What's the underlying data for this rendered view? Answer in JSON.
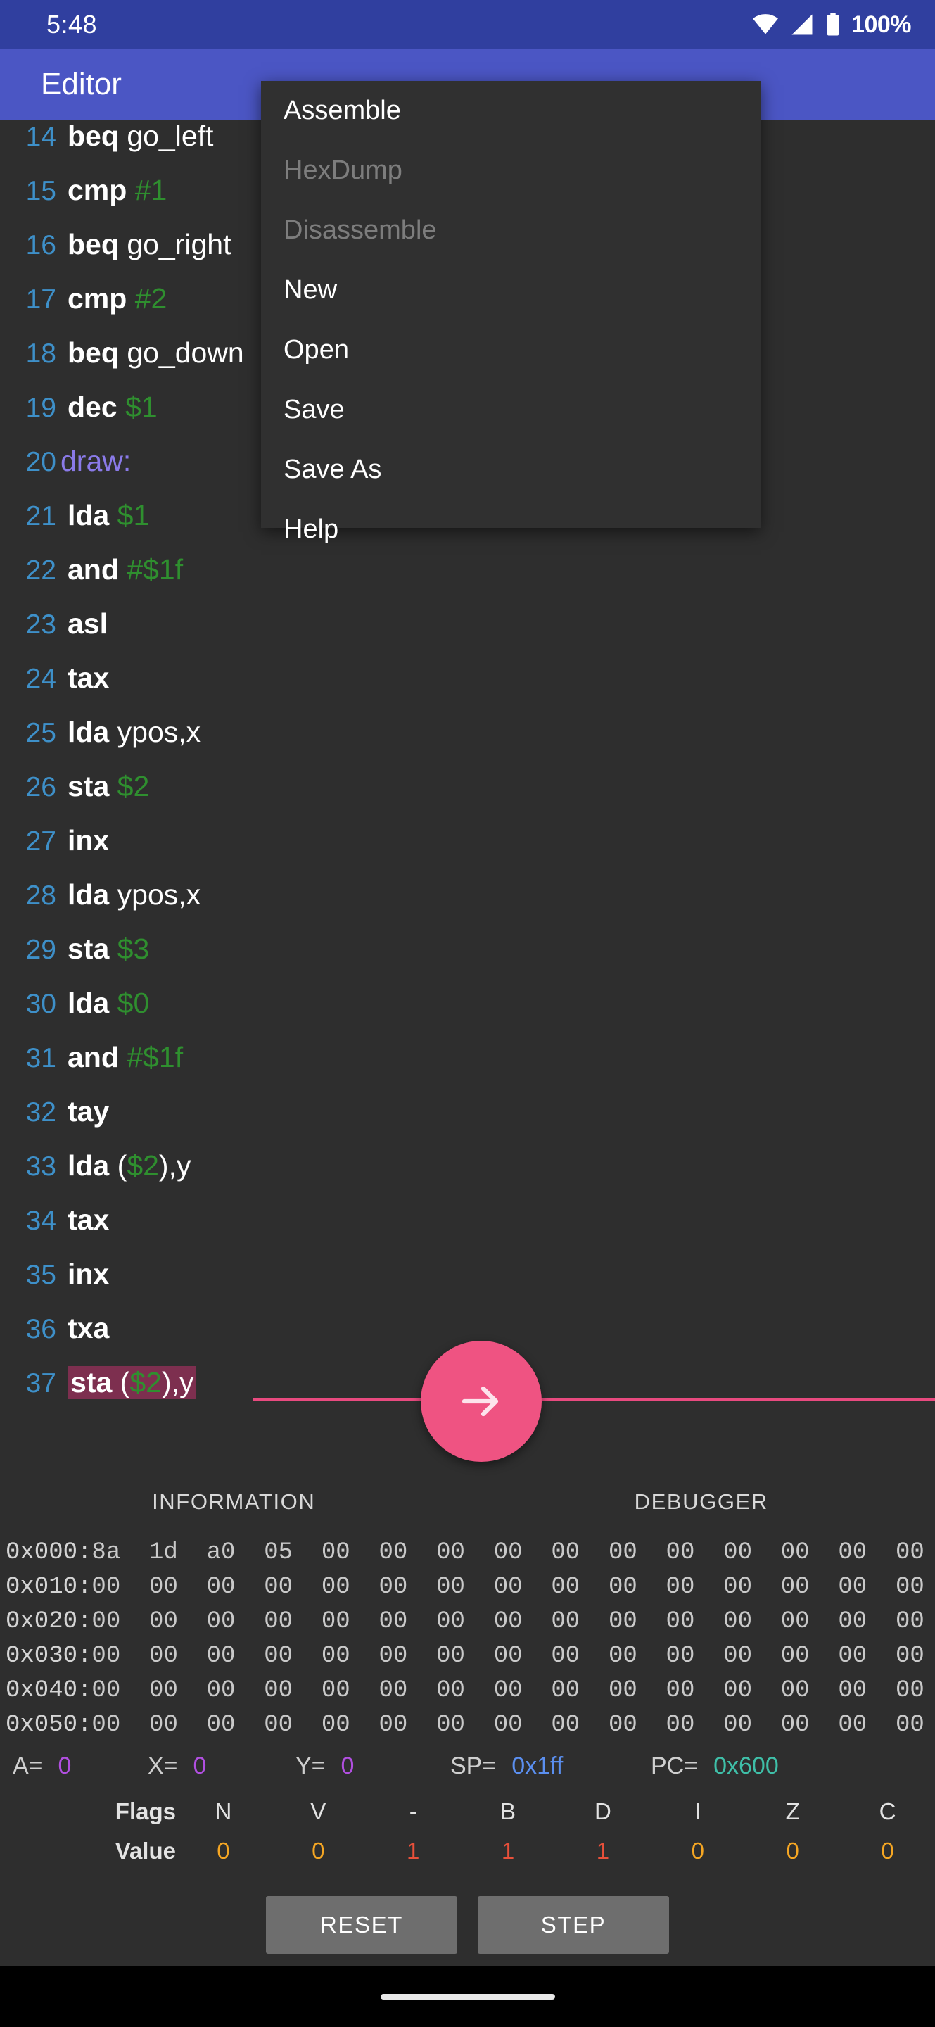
{
  "status_bar": {
    "time": "5:48",
    "battery_percent": "100%",
    "icons": [
      "wifi-icon",
      "cellular-signal-icon",
      "battery-icon"
    ]
  },
  "app_bar": {
    "title": "Editor"
  },
  "overflow_menu": {
    "items": [
      {
        "label": "Assemble",
        "disabled": false
      },
      {
        "label": "HexDump",
        "disabled": true
      },
      {
        "label": "Disassemble",
        "disabled": true
      },
      {
        "label": "New",
        "disabled": false
      },
      {
        "label": "Open",
        "disabled": false
      },
      {
        "label": "Save",
        "disabled": false
      },
      {
        "label": "Save As",
        "disabled": false
      },
      {
        "label": "Help",
        "disabled": false
      }
    ]
  },
  "editor": {
    "lines": [
      {
        "no": "14",
        "type": "instr",
        "mnemonic": "beq",
        "operand": "go_left",
        "operand_kind": "plain",
        "selected": false
      },
      {
        "no": "15",
        "type": "instr",
        "mnemonic": "cmp",
        "operand": "#1",
        "operand_kind": "number",
        "selected": false
      },
      {
        "no": "16",
        "type": "instr",
        "mnemonic": "beq",
        "operand": "go_right",
        "operand_kind": "plain",
        "selected": false
      },
      {
        "no": "17",
        "type": "instr",
        "mnemonic": "cmp",
        "operand": "#2",
        "operand_kind": "number",
        "selected": false
      },
      {
        "no": "18",
        "type": "instr",
        "mnemonic": "beq",
        "operand": "go_down",
        "operand_kind": "plain",
        "selected": false
      },
      {
        "no": "19",
        "type": "instr",
        "mnemonic": "dec",
        "operand": "$1",
        "operand_kind": "number",
        "selected": false
      },
      {
        "no": "20",
        "type": "label",
        "mnemonic": "draw:",
        "operand": "",
        "operand_kind": "label",
        "selected": false
      },
      {
        "no": "21",
        "type": "instr",
        "mnemonic": "lda",
        "operand": "$1",
        "operand_kind": "number",
        "selected": false
      },
      {
        "no": "22",
        "type": "instr",
        "mnemonic": "and",
        "operand": "#$1f",
        "operand_kind": "number",
        "selected": false
      },
      {
        "no": "23",
        "type": "instr",
        "mnemonic": "asl",
        "operand": "",
        "operand_kind": "plain",
        "selected": false
      },
      {
        "no": "24",
        "type": "instr",
        "mnemonic": "tax",
        "operand": "",
        "operand_kind": "plain",
        "selected": false
      },
      {
        "no": "25",
        "type": "instr",
        "mnemonic": "lda",
        "operand": "ypos,x",
        "operand_kind": "plain",
        "selected": false
      },
      {
        "no": "26",
        "type": "instr",
        "mnemonic": "sta",
        "operand": "$2",
        "operand_kind": "number",
        "selected": false
      },
      {
        "no": "27",
        "type": "instr",
        "mnemonic": "inx",
        "operand": "",
        "operand_kind": "plain",
        "selected": false
      },
      {
        "no": "28",
        "type": "instr",
        "mnemonic": "lda",
        "operand": "ypos,x",
        "operand_kind": "plain",
        "selected": false
      },
      {
        "no": "29",
        "type": "instr",
        "mnemonic": "sta",
        "operand": "$3",
        "operand_kind": "number",
        "selected": false
      },
      {
        "no": "30",
        "type": "instr",
        "mnemonic": "lda",
        "operand": "$0",
        "operand_kind": "number",
        "selected": false
      },
      {
        "no": "31",
        "type": "instr",
        "mnemonic": "and",
        "operand": "#$1f",
        "operand_kind": "number",
        "selected": false
      },
      {
        "no": "32",
        "type": "instr",
        "mnemonic": "tay",
        "operand": "",
        "operand_kind": "plain",
        "selected": false
      },
      {
        "no": "33",
        "type": "instr",
        "mnemonic": "lda",
        "operand": "($2),y",
        "operand_kind": "indirect",
        "selected": false
      },
      {
        "no": "34",
        "type": "instr",
        "mnemonic": "tax",
        "operand": "",
        "operand_kind": "plain",
        "selected": false
      },
      {
        "no": "35",
        "type": "instr",
        "mnemonic": "inx",
        "operand": "",
        "operand_kind": "plain",
        "selected": false
      },
      {
        "no": "36",
        "type": "instr",
        "mnemonic": "txa",
        "operand": "",
        "operand_kind": "plain",
        "selected": false
      },
      {
        "no": "37",
        "type": "instr",
        "mnemonic": "sta",
        "operand": "($2),y",
        "operand_kind": "indirect",
        "selected": true
      }
    ]
  },
  "fab": {
    "icon": "arrow-right-icon"
  },
  "tabs": [
    {
      "label": "INFORMATION",
      "active": false
    },
    {
      "label": "DEBUGGER",
      "active": true
    }
  ],
  "hexdump": {
    "rows": [
      {
        "addr": "0x000:",
        "bytes": [
          "8a",
          "1d",
          "a0",
          "05",
          "00",
          "00",
          "00",
          "00",
          "00",
          "00",
          "00",
          "00",
          "00",
          "00",
          "00",
          "00"
        ]
      },
      {
        "addr": "0x010:",
        "bytes": [
          "00",
          "00",
          "00",
          "00",
          "00",
          "00",
          "00",
          "00",
          "00",
          "00",
          "00",
          "00",
          "00",
          "00",
          "00",
          "00"
        ]
      },
      {
        "addr": "0x020:",
        "bytes": [
          "00",
          "00",
          "00",
          "00",
          "00",
          "00",
          "00",
          "00",
          "00",
          "00",
          "00",
          "00",
          "00",
          "00",
          "00",
          "00"
        ]
      },
      {
        "addr": "0x030:",
        "bytes": [
          "00",
          "00",
          "00",
          "00",
          "00",
          "00",
          "00",
          "00",
          "00",
          "00",
          "00",
          "00",
          "00",
          "00",
          "00",
          "00"
        ]
      },
      {
        "addr": "0x040:",
        "bytes": [
          "00",
          "00",
          "00",
          "00",
          "00",
          "00",
          "00",
          "00",
          "00",
          "00",
          "00",
          "00",
          "00",
          "00",
          "00",
          "00"
        ]
      },
      {
        "addr": "0x050:",
        "bytes": [
          "00",
          "00",
          "00",
          "00",
          "00",
          "00",
          "00",
          "00",
          "00",
          "00",
          "00",
          "00",
          "00",
          "00",
          "00",
          "00"
        ]
      }
    ]
  },
  "registers": [
    {
      "name": "A=",
      "value": "0",
      "color_class": "purple"
    },
    {
      "name": "X=",
      "value": "0",
      "color_class": "purple"
    },
    {
      "name": "Y=",
      "value": "0",
      "color_class": "purple"
    },
    {
      "name": "SP=",
      "value": "0x1ff",
      "color_class": "blue"
    },
    {
      "name": "PC=",
      "value": "0x600",
      "color_class": "teal"
    }
  ],
  "flags": {
    "row_labels": {
      "flags": "Flags",
      "value": "Value"
    },
    "names": [
      "N",
      "V",
      "-",
      "B",
      "D",
      "I",
      "Z",
      "C"
    ],
    "values": [
      "0",
      "0",
      "1",
      "1",
      "1",
      "0",
      "0",
      "0"
    ]
  },
  "buttons": {
    "reset": "RESET",
    "step": "STEP"
  },
  "colors": {
    "status_bar": "#303f9f",
    "app_bar": "#4b56c4",
    "editor_bg": "#2e2e2e",
    "menu_bg": "#303030",
    "accent_pink": "#ef5382",
    "line_number": "#3e90c9",
    "operand_green": "#2f8f2f",
    "label_violet": "#8a7ae8",
    "selection": "#7d2f4f",
    "flag_zero": "#f5a623",
    "flag_one": "#e8503a"
  }
}
